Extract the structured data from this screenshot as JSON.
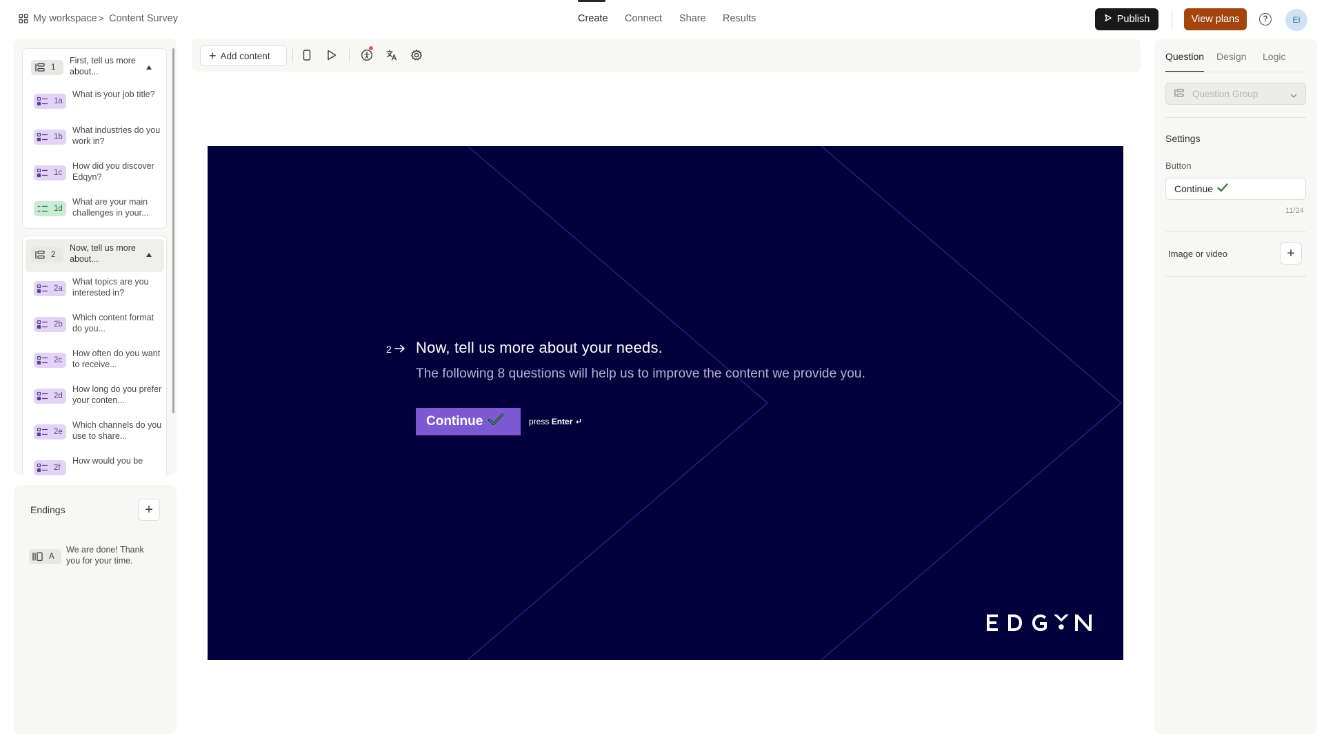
{
  "topbar": {
    "workspace": "My workspace",
    "separator": ">",
    "form_name": "Content Survey",
    "tabs": [
      {
        "label": "Create",
        "active": true
      },
      {
        "label": "Connect",
        "active": false
      },
      {
        "label": "Share",
        "active": false
      },
      {
        "label": "Results",
        "active": false
      }
    ],
    "publish_label": "Publish",
    "plans_label": "View plans",
    "help_glyph": "?",
    "avatar_initials": "EI"
  },
  "sidebar": {
    "groups": [
      {
        "number": "1",
        "title": "First, tell us more about...",
        "items": [
          {
            "number": "1a",
            "title": "What is your job title?",
            "kind": "purple"
          },
          {
            "number": "1b",
            "title": "What industries do you work in?",
            "kind": "purple"
          },
          {
            "number": "1c",
            "title": "How did you discover Edqyn?",
            "kind": "purple"
          },
          {
            "number": "1d",
            "title": "What are your main challenges in your...",
            "kind": "green"
          }
        ]
      },
      {
        "number": "2",
        "title": "Now, tell us more about...",
        "items": [
          {
            "number": "2a",
            "title": "What topics are you interested in?",
            "kind": "purple"
          },
          {
            "number": "2b",
            "title": "Which content format do you...",
            "kind": "purple"
          },
          {
            "number": "2c",
            "title": "How often do you want to receive...",
            "kind": "purple"
          },
          {
            "number": "2d",
            "title": "How long do you prefer your conten...",
            "kind": "purple"
          },
          {
            "number": "2e",
            "title": "Which channels do you use to share...",
            "kind": "purple"
          },
          {
            "number": "2f",
            "title": "How would you be",
            "kind": "purple"
          }
        ]
      }
    ],
    "endings": {
      "label": "Endings",
      "add_glyph": "+",
      "items": [
        {
          "badge": "A",
          "title": "We are done! Thank you for your time."
        }
      ]
    }
  },
  "toolbar": {
    "add_content_label": "Add content",
    "add_glyph": "+"
  },
  "canvas": {
    "question_number": "2",
    "title": "Now, tell us more about your needs.",
    "description": "The following 8 questions will help us to improve the content we provide you.",
    "button_label": "Continue",
    "hint_prefix": "press",
    "hint_key": "Enter",
    "logo_text": "EDGYN",
    "colors": {
      "background": "#03013b",
      "button": "#7d5ad4",
      "text": "#ffffff",
      "description": "#b9b3d6"
    }
  },
  "right_panel": {
    "tabs": [
      {
        "label": "Question",
        "active": true
      },
      {
        "label": "Design",
        "active": false
      },
      {
        "label": "Logic",
        "active": false
      }
    ],
    "type_select": "Question Group",
    "settings_label": "Settings",
    "button_label_heading": "Button",
    "button_value": "Continue",
    "char_counter": "11/24",
    "media_label": "Image or video",
    "add_glyph": "+"
  },
  "icons": [
    "grid-icon",
    "publish-play-icon",
    "help-icon",
    "mobile-preview-icon",
    "play-preview-icon",
    "accessibility-icon",
    "translate-icon",
    "settings-gear-icon",
    "question-group-icon",
    "list-choice-icon",
    "ending-icon",
    "checkmark-icon",
    "arrow-right-icon",
    "enter-key-icon",
    "chevron-down-icon"
  ]
}
